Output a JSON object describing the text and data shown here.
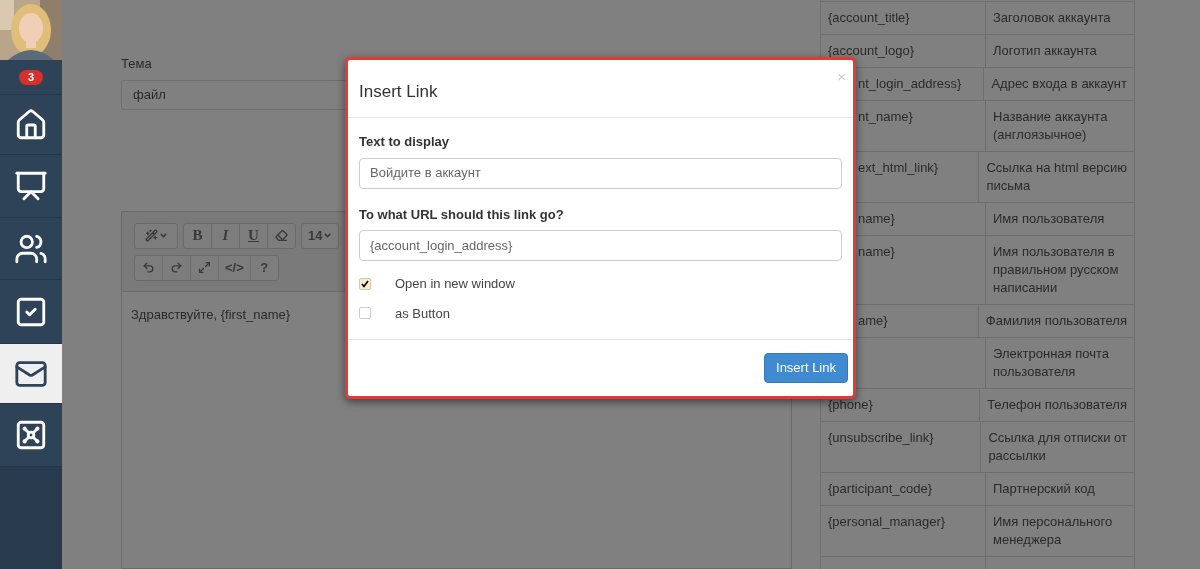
{
  "sidebar": {
    "badge": "3",
    "items": [
      {
        "selected": false
      },
      {
        "selected": false
      },
      {
        "selected": false
      },
      {
        "selected": false
      },
      {
        "selected": true
      },
      {
        "selected": false
      }
    ]
  },
  "subject": {
    "label": "Тема",
    "value": "файл"
  },
  "editor": {
    "toolbar": [
      [
        [
          {
            "kind": "icon",
            "caret": true
          }
        ],
        [
          {
            "kind": "text",
            "label": "B"
          },
          {
            "kind": "text",
            "label": "I"
          },
          {
            "kind": "text",
            "label": "U"
          },
          {
            "kind": "icon"
          }
        ],
        [
          {
            "kind": "text",
            "label": "14",
            "caret": true
          }
        ]
      ],
      [
        [
          {
            "kind": "icon"
          },
          {
            "kind": "icon"
          },
          {
            "kind": "icon"
          },
          {
            "kind": "text",
            "label": "</>"
          },
          {
            "kind": "text",
            "label": "?"
          }
        ]
      ]
    ],
    "content": "Здравствуйте, {first_name}"
  },
  "variables": [
    {
      "name": "{account_title}",
      "description": [
        "Заголовок аккаунта"
      ],
      "covered": false
    },
    {
      "name": "{account_logo}",
      "description": [
        "Логотип аккаунта"
      ],
      "covered": false
    },
    {
      "name": "nt_login_address}",
      "description": [
        "Адрес входа в аккаунт"
      ],
      "covered": true
    },
    {
      "name": "nt_name}",
      "description": [
        "Название аккаунта",
        "(англоязычное)"
      ],
      "covered": true
    },
    {
      "name": "ext_html_link}",
      "description": [
        "Ссылка на html версию",
        "письма"
      ],
      "covered": true
    },
    {
      "name": "name}",
      "description": [
        "Имя пользователя"
      ],
      "covered": true
    },
    {
      "name": "name}",
      "description": [
        "Имя пользователя в",
        "правильном русском",
        "написании"
      ],
      "covered": true
    },
    {
      "name": "ame}",
      "description": [
        "Фамилия пользователя"
      ],
      "covered": true
    },
    {
      "description": [
        "Электронная почта",
        "пользователя"
      ]
    },
    {
      "name": "{phone}",
      "description": [
        "Телефон пользователя"
      ],
      "covered": false
    },
    {
      "name": "{unsubscribe_link}",
      "description": [
        "Ссылка для отписки от",
        "рассылки"
      ],
      "covered": false
    },
    {
      "name": "{participant_code}",
      "description": [
        "Партнерский код"
      ],
      "covered": false
    },
    {
      "name": "{personal_manager}",
      "description": [
        "Имя персонального",
        "менеджера"
      ],
      "covered": false
    }
  ],
  "dialog": {
    "title": "Insert Link",
    "close": "×",
    "text_label": "Text to display",
    "text_value": "Войдите в аккаунт",
    "url_label": "To what URL should this link go?",
    "url_value": "{account_login_address}",
    "options": [
      {
        "label": "Open in new window",
        "checked": true
      },
      {
        "label": "as Button",
        "checked": false
      }
    ],
    "button": "Insert Link"
  }
}
